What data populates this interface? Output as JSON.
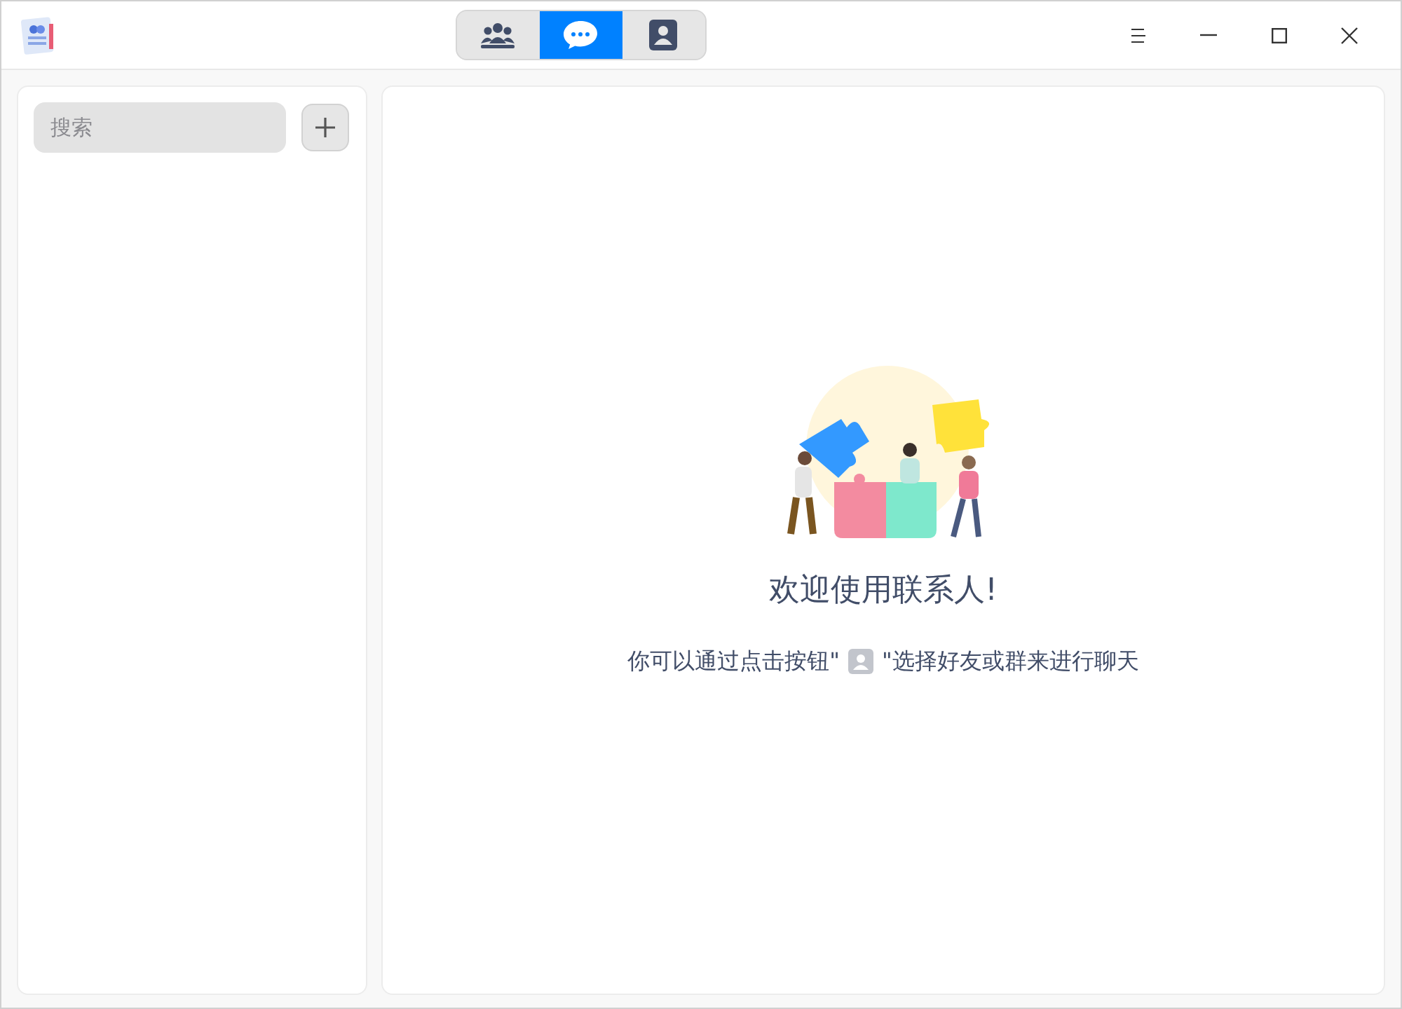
{
  "tabs": [
    {
      "kind": "groups",
      "selected": false
    },
    {
      "kind": "chat",
      "selected": true
    },
    {
      "kind": "contacts",
      "selected": false
    }
  ],
  "search": {
    "placeholder": "搜索"
  },
  "welcome": {
    "title": "欢迎使用联系人!",
    "hint_before": "你可以通过点击按钮\"",
    "hint_after": "\"选择好友或群来进行聊天"
  }
}
